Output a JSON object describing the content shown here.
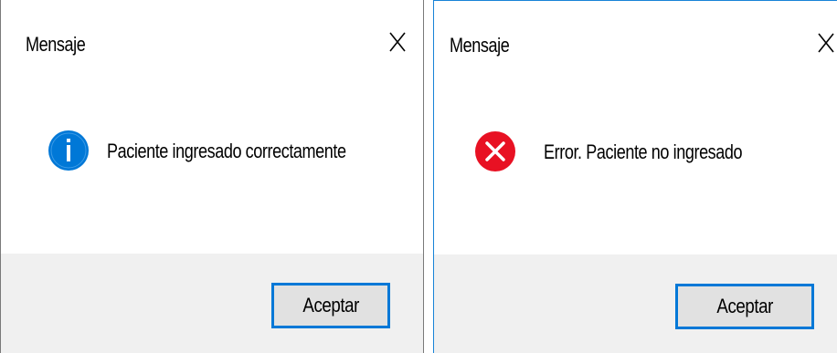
{
  "dialogs": [
    {
      "title": "Mensaje",
      "message": "Paciente ingresado correctamente",
      "icon": "info-icon",
      "icon_color": "#0078d7",
      "button_label": "Aceptar"
    },
    {
      "title": "Mensaje",
      "message": "Error. Paciente no ingresado",
      "icon": "error-icon",
      "icon_color": "#e81123",
      "button_label": "Aceptar"
    }
  ],
  "colors": {
    "accent": "#0078d7",
    "footer_bg": "#f0f0f0",
    "button_bg": "#e1e1e1"
  }
}
